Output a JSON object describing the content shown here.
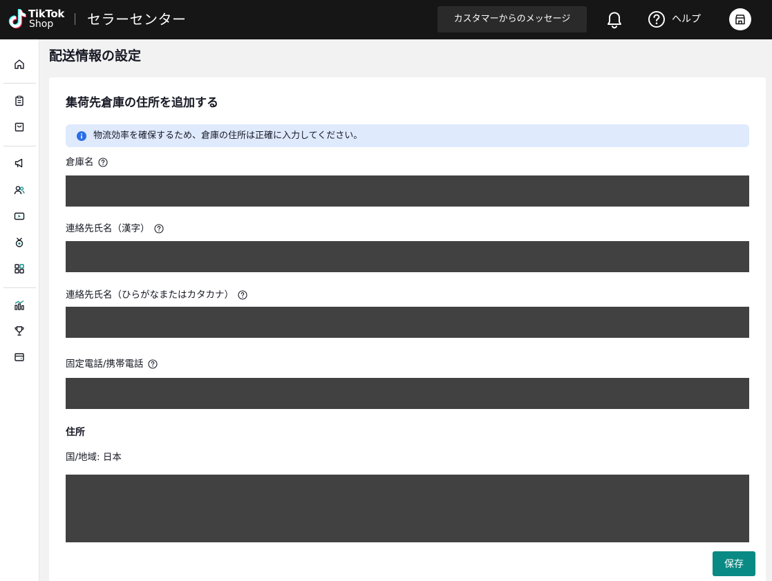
{
  "header": {
    "logo_line1": "TikTok",
    "logo_line2": "Shop",
    "app_title": "セラーセンター",
    "messages_button": "カスタマーからのメッセージ",
    "help_label": "ヘルプ"
  },
  "sidebar": {
    "icons": [
      "home-icon",
      "orders-icon",
      "products-icon",
      "marketing-icon",
      "creators-icon",
      "live-icon",
      "growth-icon",
      "apps-icon",
      "analytics-icon",
      "rewards-icon",
      "finance-icon"
    ]
  },
  "page": {
    "title": "配送情報の設定"
  },
  "form": {
    "title": "集荷先倉庫の住所を追加する",
    "info_banner": "物流効率を確保するため、倉庫の住所は正確に入力してください。",
    "fields": [
      {
        "label": "倉庫名"
      },
      {
        "label": "連絡先氏名（漢字）"
      },
      {
        "label": "連絡先氏名（ひらがなまたはカタカナ）"
      },
      {
        "label": "固定電話/携帯電話"
      }
    ],
    "address_label": "住所",
    "country_text": "国/地域:  日本",
    "save_button": "保存"
  },
  "colors": {
    "header_bg": "#161616",
    "accent": "#0a8a84",
    "info_bg": "#dfeafd",
    "info_icon": "#2b6fe8",
    "redacted": "#414141"
  }
}
